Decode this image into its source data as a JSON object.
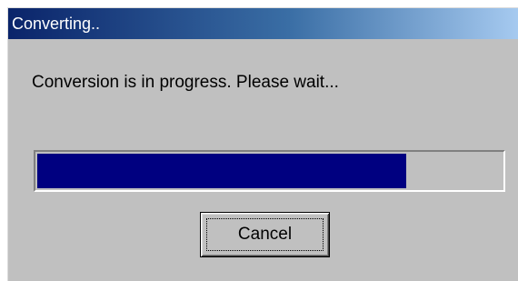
{
  "window": {
    "title": "Converting.."
  },
  "dialog": {
    "message": "Conversion is in progress. Please wait..."
  },
  "progress": {
    "fraction": 0.795,
    "fill_color": "#000080"
  },
  "buttons": {
    "cancel_label": "Cancel"
  },
  "colors": {
    "dialog_bg": "#c0c0c0",
    "titlebar_start": "#0a246a",
    "titlebar_end": "#a6caf0",
    "title_text": "#ffffff"
  }
}
